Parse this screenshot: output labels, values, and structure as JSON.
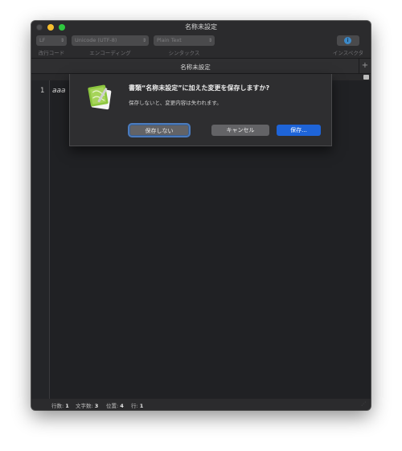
{
  "window": {
    "title": "名称未設定"
  },
  "toolbar": {
    "line_ending": {
      "value": "LF",
      "label": "改行コード"
    },
    "encoding": {
      "value": "Unicode (UTF-8)",
      "label": "エンコーディング"
    },
    "syntax": {
      "value": "Plain Text",
      "label": "シンタックス"
    },
    "inspector": {
      "label": "インスペクタ",
      "icon_glyph": "i"
    }
  },
  "tab": {
    "title": "名称未設定",
    "add_glyph": "+"
  },
  "editor": {
    "line_number": "1",
    "content": "aaa"
  },
  "status": {
    "lines_label": "行数:",
    "lines_value": "1",
    "chars_label": "文字数:",
    "chars_value": "3",
    "position_label": "位置:",
    "position_value": "4",
    "line_label": "行:",
    "line_value": "1"
  },
  "dialog": {
    "title": "書類“名称未設定”に加えた変更を保存しますか?",
    "message": "保存しないと、変更内容は失われます。",
    "dont_save": "保存しない",
    "cancel": "キャンセル",
    "save": "保存..."
  },
  "colors": {
    "accent": "#1e64d8",
    "focus_ring": "#4b7bbd",
    "app_icon_green": "#8cc63e"
  }
}
